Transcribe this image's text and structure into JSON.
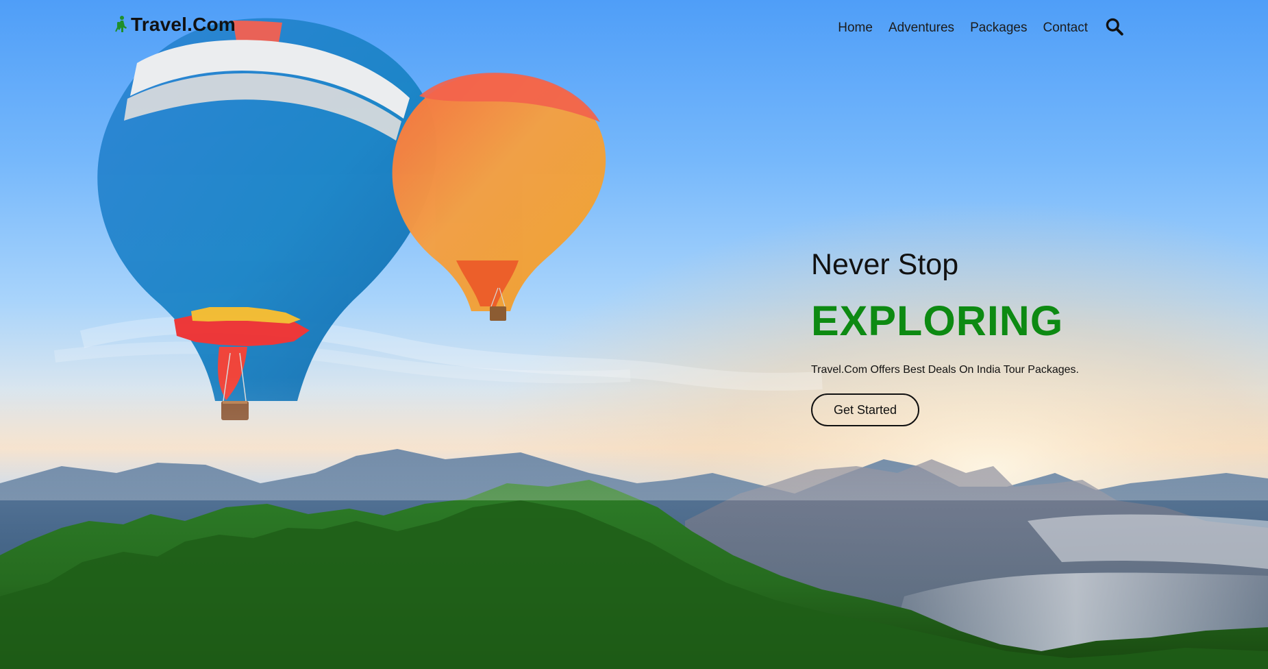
{
  "brand": {
    "name": "Travel.Com",
    "icon": "hiker-icon",
    "color": "#1f8f2b"
  },
  "nav": {
    "items": [
      {
        "label": "Home"
      },
      {
        "label": "Adventures"
      },
      {
        "label": "Packages"
      },
      {
        "label": "Contact"
      }
    ],
    "search_icon": "search-icon"
  },
  "hero": {
    "kicker": "Never Stop",
    "title": "EXPLORING",
    "subtitle": "Travel.Com Offers Best Deals On India Tour Packages.",
    "cta_label": "Get Started",
    "accent_color": "#0d8a12"
  }
}
